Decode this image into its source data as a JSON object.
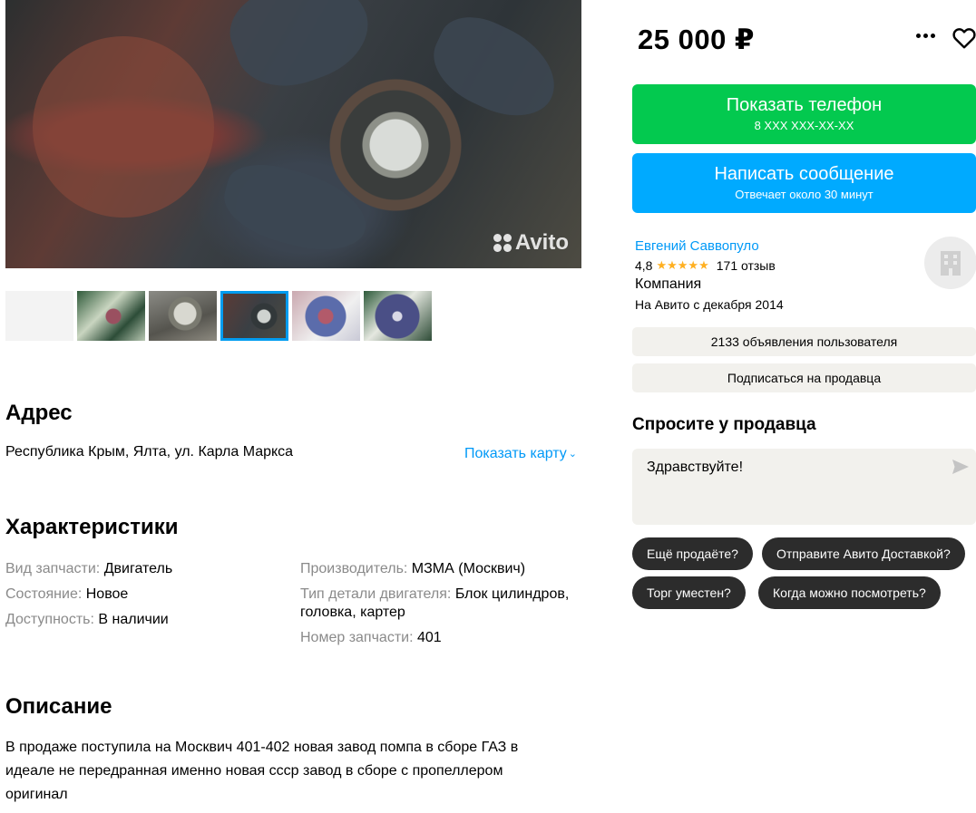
{
  "gallery": {
    "watermark": "Avito",
    "thumbnails": [
      "",
      "",
      "",
      "",
      "",
      ""
    ],
    "active_thumbnail": 3
  },
  "address": {
    "title": "Адрес",
    "text": "Республика Крым, Ялта, ул. Карла Маркса",
    "show_map": "Показать карту"
  },
  "characteristics": {
    "title": "Характеристики",
    "col1": [
      {
        "key": "Вид запчасти:",
        "value": "Двигатель"
      },
      {
        "key": "Состояние:",
        "value": "Новое"
      },
      {
        "key": "Доступность:",
        "value": "В наличии"
      }
    ],
    "col2": [
      {
        "key": "Производитель:",
        "value": "МЗМА (Москвич)"
      },
      {
        "key": "Тип детали двигателя:",
        "value": "Блок цилиндров, головка, картер"
      },
      {
        "key": "Номер запчасти:",
        "value": "401"
      }
    ]
  },
  "description": {
    "title": "Описание",
    "text": "В продаже поступила на Москвич 401-402 новая завод помпа в сборе ГАЗ в идеале не передранная именно новая ссср завод в сборе с пропеллером оригинал"
  },
  "offer": {
    "price": "25 000 ₽",
    "phone_button": {
      "label": "Показать телефон",
      "sub": "8 XXX XXX-XX-XX"
    },
    "message_button": {
      "label": "Написать сообщение",
      "sub": "Отвечает около 30 минут"
    }
  },
  "seller": {
    "name": "Евгений Саввопуло",
    "rating": "4,8",
    "stars": "★★★★★",
    "reviews": "171 отзыв",
    "type": "Компания",
    "since": "На Авито с декабря 2014",
    "ads_button": "2133 объявления пользователя",
    "subscribe_button": "Подписаться на продавца"
  },
  "ask": {
    "title": "Спросите у продавца",
    "message": "Здравствуйте!",
    "quick_replies": [
      "Ещё продаёте?",
      "Отправите Авито Доставкой?",
      "Торг уместен?",
      "Когда можно посмотреть?"
    ]
  },
  "colors": {
    "phone_green": "#03c94f",
    "message_blue": "#00aaff",
    "link_blue": "#0099f7",
    "star_yellow": "#ffb021",
    "chip_dark": "#2c2c2c"
  }
}
